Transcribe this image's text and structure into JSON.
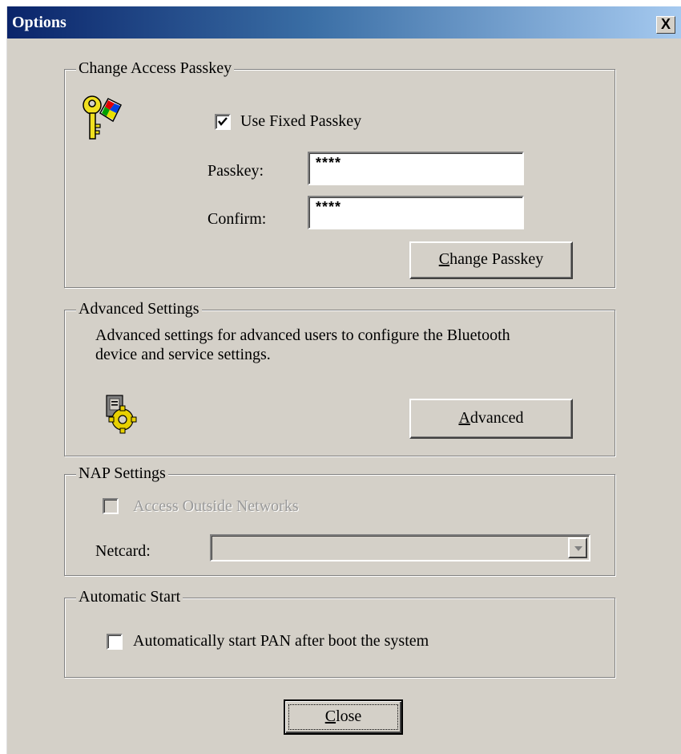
{
  "window": {
    "title": "Options",
    "close_glyph": "X"
  },
  "passkey_group": {
    "legend": "Change Access Passkey",
    "icon": "key-icon",
    "use_fixed": {
      "label": "Use Fixed Passkey",
      "checked": true
    },
    "passkey": {
      "label": "Passkey:",
      "value": "****"
    },
    "confirm": {
      "label": "Confirm:",
      "value": "****"
    },
    "change_button": {
      "mnemonic": "C",
      "rest": "hange Passkey"
    }
  },
  "advanced_group": {
    "legend": "Advanced Settings",
    "description_line1": "Advanced settings for advanced users to configure the Bluetooth",
    "description_line2": "device and service settings.",
    "icon": "settings-gear-icon",
    "advanced_button": {
      "mnemonic": "A",
      "rest": "dvanced"
    }
  },
  "nap_group": {
    "legend": "NAP Settings",
    "access_outside": {
      "label": "Access Outside Networks",
      "checked": false,
      "disabled": true
    },
    "netcard": {
      "label": "Netcard:",
      "value": "",
      "disabled": true
    }
  },
  "autostart_group": {
    "legend": "Automatic Start",
    "auto_pan": {
      "label": "Automatically start PAN after boot the system",
      "checked": false
    }
  },
  "footer": {
    "close_button": {
      "mnemonic": "C",
      "rest": "lose"
    }
  },
  "colors": {
    "face": "#d4d0c8",
    "title_start": "#0a246a",
    "title_end": "#a6caf0"
  }
}
